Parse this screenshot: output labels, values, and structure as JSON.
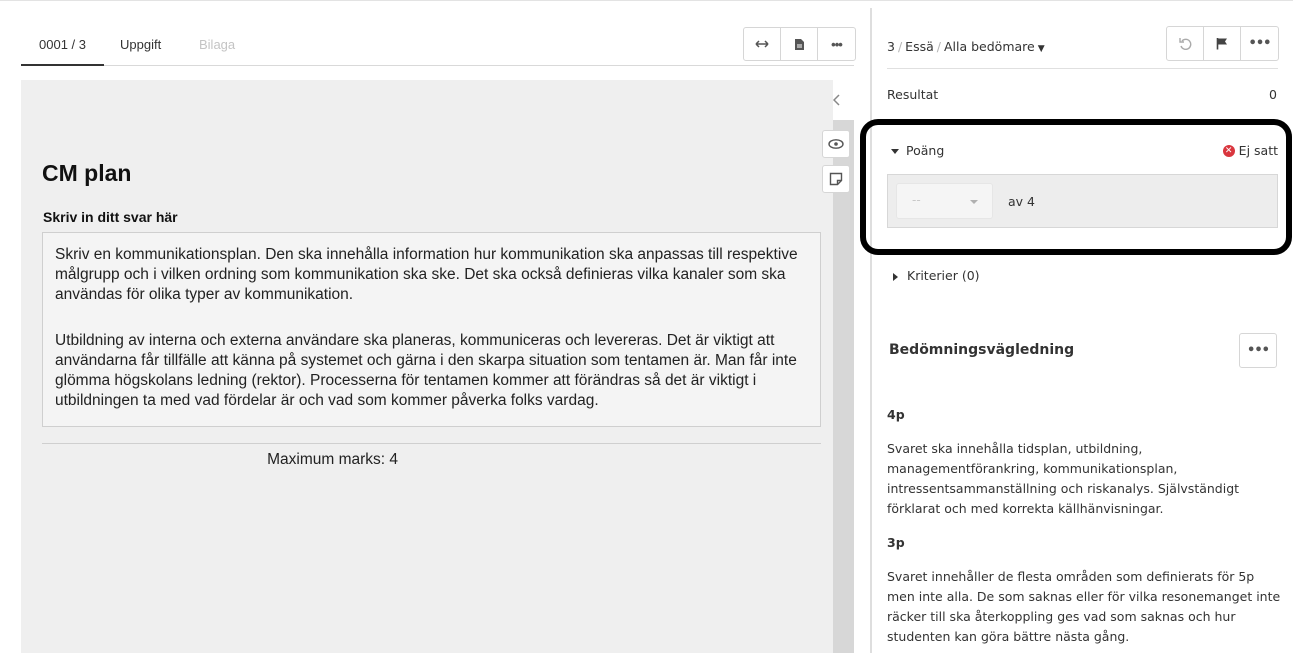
{
  "left": {
    "tabs": [
      {
        "label": "0001 / 3",
        "active": true
      },
      {
        "label": "Uppgift",
        "active": false
      },
      {
        "label": "Bilaga",
        "active": false,
        "disabled": true
      }
    ],
    "toolbar_icons": [
      "expand-horizontal-icon",
      "document-icon",
      "more-icon"
    ],
    "question": {
      "title": "CM plan",
      "subtitle": "Skriv in ditt svar här",
      "answer_paragraphs": [
        "Skriv en kommunikationsplan. Den ska innehålla information hur kommunikation ska anpassas till respektive målgrupp och i vilken ordning som kommunikation ska ske. Det ska också definieras vilka kanaler som ska användas för olika typer av kommunikation.",
        "Utbildning av interna och externa användare ska planeras, kommuniceras och levereras. Det är viktigt att användarna får tillfälle att känna på systemet och gärna i den skarpa situation som tentamen är. Man får inte glömma högskolans ledning (rektor). Processerna för tentamen kommer att förändras så det är viktigt i utbildningen ta med vad fördelar är och vad som kommer påverka folks vardag."
      ],
      "max_marks": "Maximum marks: 4"
    }
  },
  "right": {
    "breadcrumb": {
      "number": "3",
      "type": "Essä",
      "graders": "Alla bedömare"
    },
    "toolbar_icons": [
      "undo-icon",
      "flag-icon",
      "more-icon"
    ],
    "result": {
      "label": "Resultat",
      "value": "0"
    },
    "points": {
      "label": "Poäng",
      "status": "Ej satt",
      "select_value": "--",
      "out_of": "av 4"
    },
    "criteria": {
      "label": "Kriterier (0)"
    },
    "guide": {
      "title": "Bedömningsvägledning",
      "levels": [
        {
          "level": "4p",
          "text": "Svaret ska innehålla tidsplan, utbildning, managementförankring, kommunikationsplan, intressentsammanställning och riskanalys. Självständigt förklarat och med korrekta källhänvisningar."
        },
        {
          "level": "3p",
          "text": "Svaret innehåller de flesta områden som definierats för 5p men inte alla. De som saknas eller för vilka resonemanget inte räcker till ska återkoppling ges vad som saknas och hur studenten kan göra bättre nästa gång."
        }
      ]
    }
  },
  "colors": {
    "status_error": "#d9363e",
    "highlight_border": "#000000",
    "panel_gray": "#efefef"
  }
}
